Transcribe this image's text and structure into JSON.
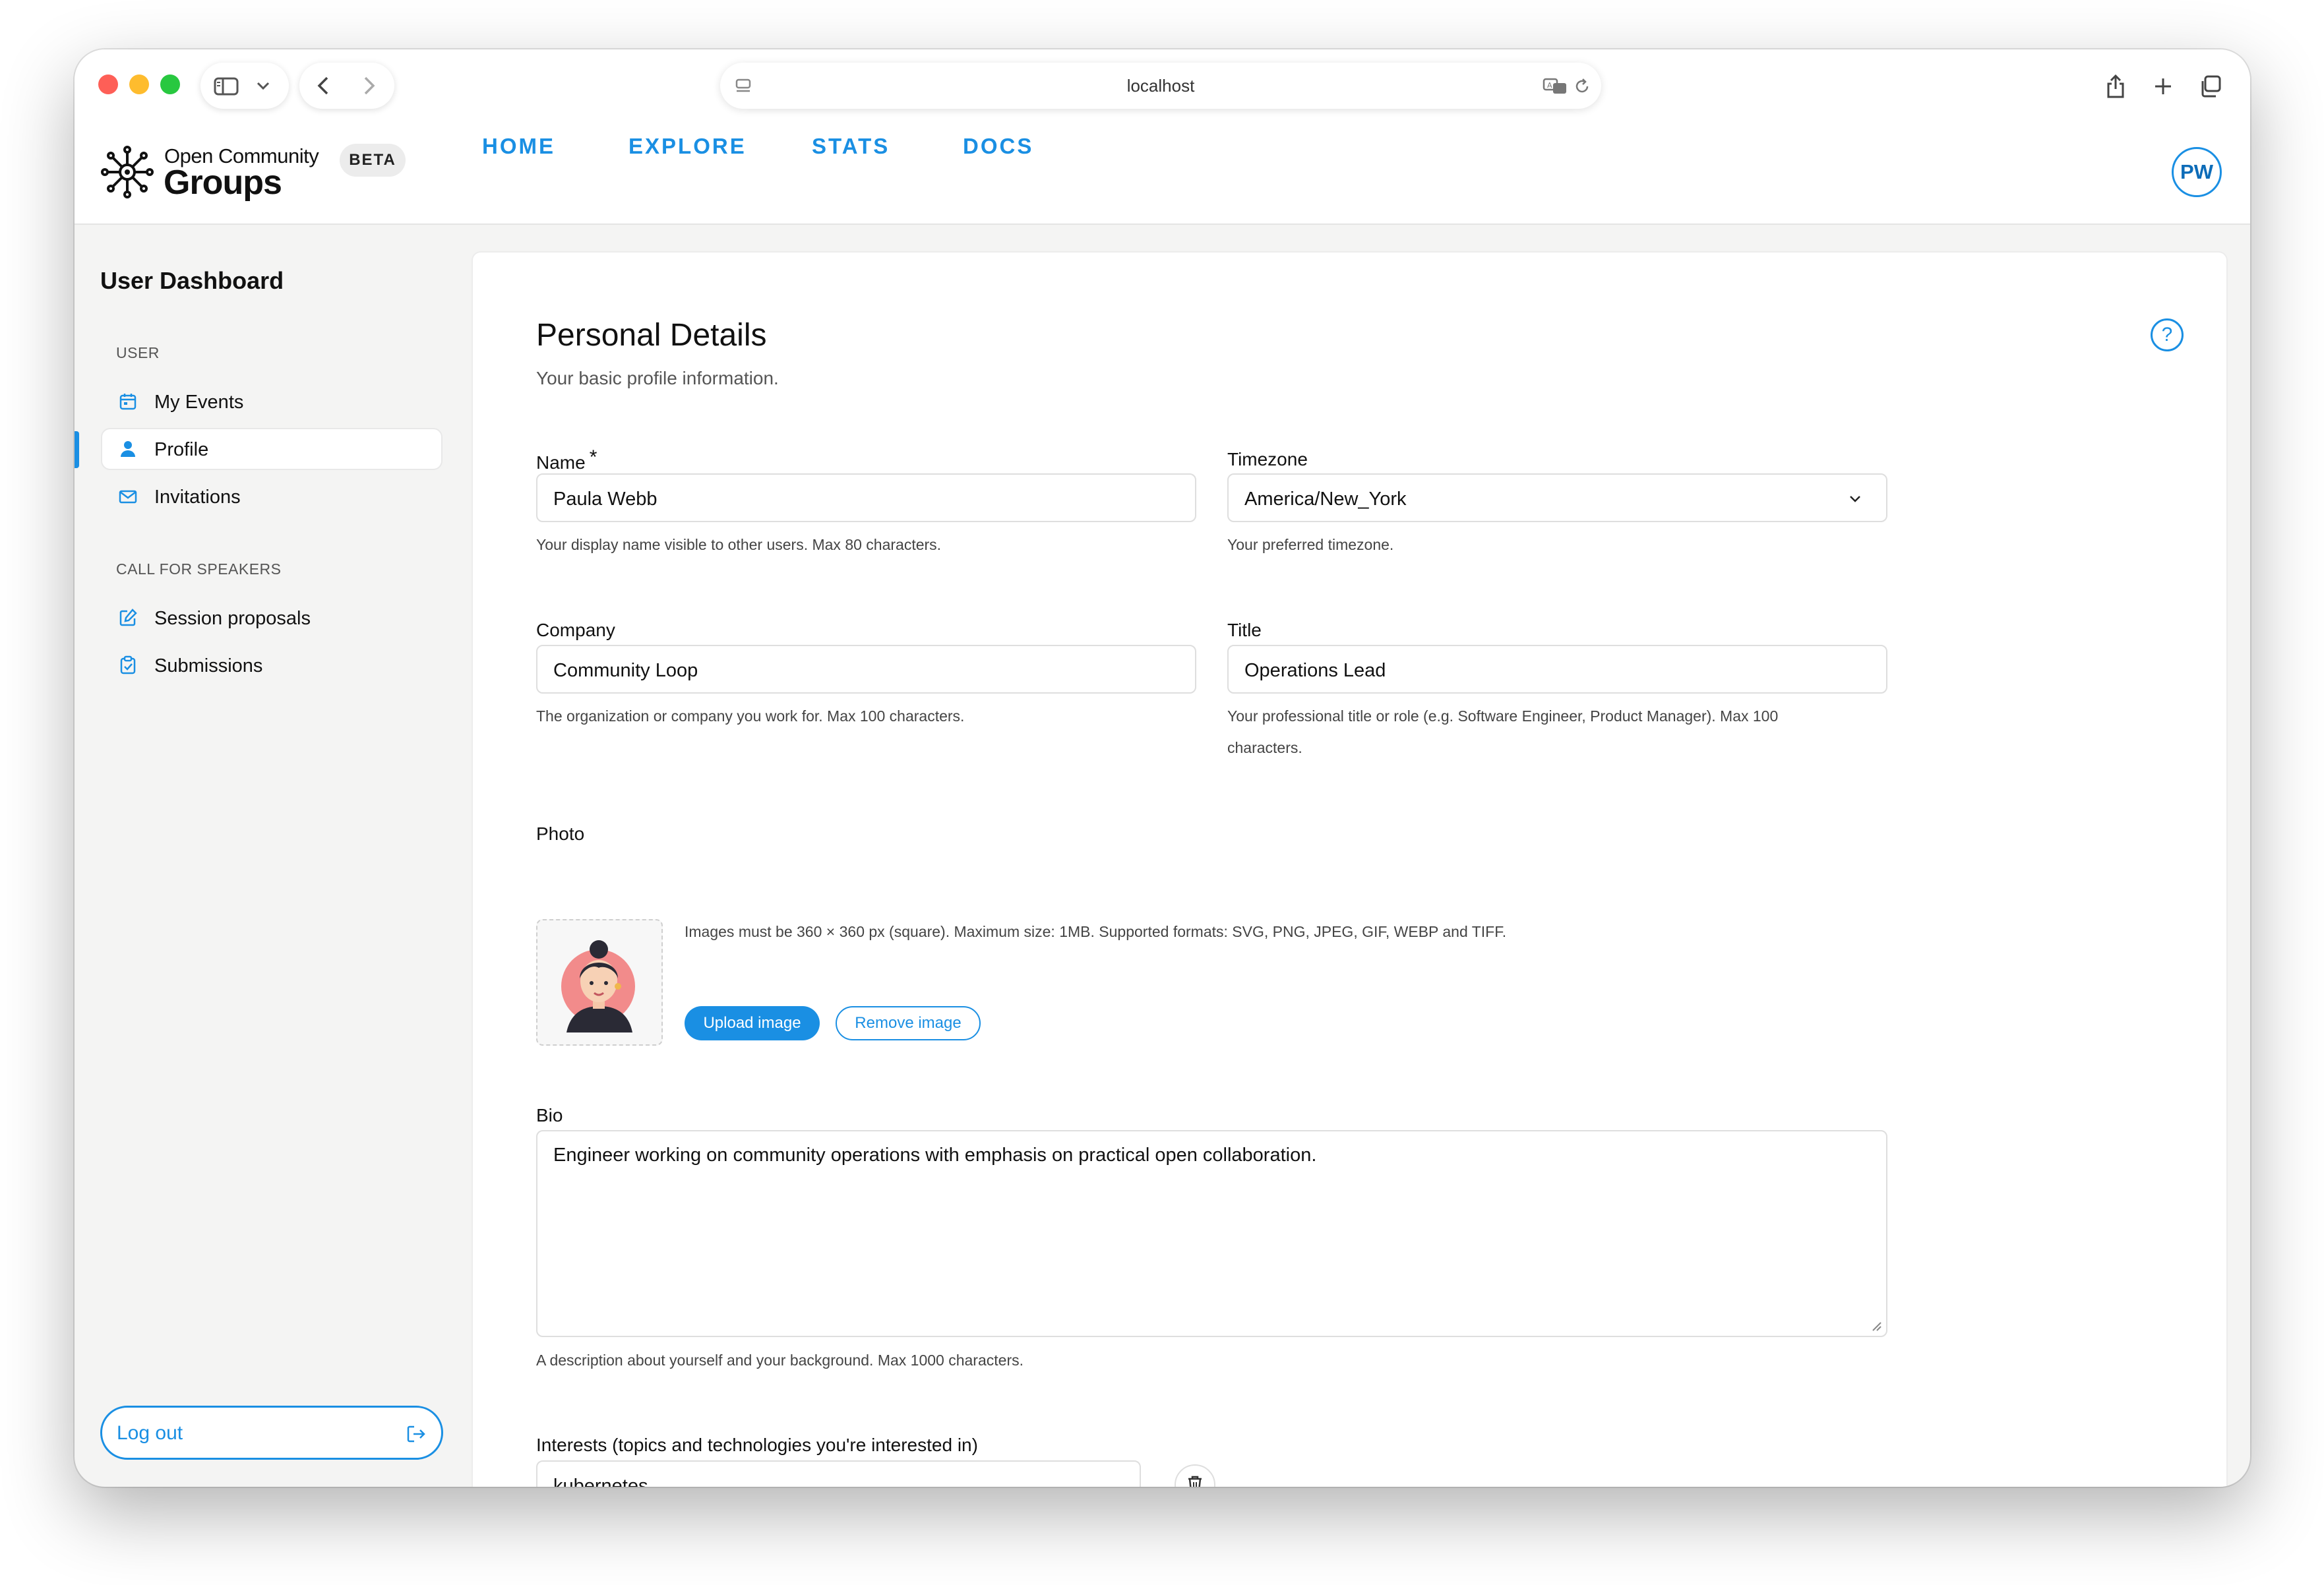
{
  "browser": {
    "url": "localhost"
  },
  "header": {
    "logo_line1": "Open Community",
    "logo_line2": "Groups",
    "badge": "BETA",
    "nav": [
      {
        "label": "HOME"
      },
      {
        "label": "EXPLORE"
      },
      {
        "label": "STATS"
      },
      {
        "label": "DOCS"
      }
    ],
    "avatar_initials": "PW"
  },
  "sidebar": {
    "title": "User Dashboard",
    "sections": [
      {
        "heading": "USER",
        "items": [
          {
            "label": "My Events",
            "icon": "calendar-icon"
          },
          {
            "label": "Profile",
            "icon": "user-icon",
            "active": true
          },
          {
            "label": "Invitations",
            "icon": "envelope-icon"
          }
        ]
      },
      {
        "heading": "CALL FOR SPEAKERS",
        "items": [
          {
            "label": "Session proposals",
            "icon": "edit-icon"
          },
          {
            "label": "Submissions",
            "icon": "clipboard-check-icon"
          }
        ]
      }
    ],
    "logout_label": "Log out"
  },
  "main": {
    "title": "Personal Details",
    "subtitle": "Your basic profile information.",
    "fields": {
      "name": {
        "label": "Name",
        "required_mark": "*",
        "value": "Paula Webb",
        "help": "Your display name visible to other users. Max 80 characters."
      },
      "timezone": {
        "label": "Timezone",
        "value": "America/New_York",
        "help": "Your preferred timezone."
      },
      "company": {
        "label": "Company",
        "value": "Community Loop",
        "help": "The organization or company you work for. Max 100 characters."
      },
      "title": {
        "label": "Title",
        "value": "Operations Lead",
        "help_line1": "Your professional title or role (e.g. Software Engineer, Product Manager). Max 100",
        "help_line2": "characters."
      },
      "photo": {
        "label": "Photo",
        "help": "Images must be 360 × 360 px (square). Maximum size: 1MB. Supported formats: SVG, PNG, JPEG, GIF, WEBP and TIFF.",
        "upload_label": "Upload image",
        "remove_label": "Remove image"
      },
      "bio": {
        "label": "Bio",
        "value": "Engineer working on community operations with emphasis on practical open collaboration.",
        "help": "A description about yourself and your background. Max 1000 characters."
      },
      "interests": {
        "label": "Interests (topics and technologies you're interested in)",
        "items": [
          "kubernetes",
          ""
        ]
      }
    }
  },
  "colors": {
    "accent": "#1a8fe3",
    "sidebar_bg": "#f4f4f3",
    "card_bg": "#ffffff"
  }
}
